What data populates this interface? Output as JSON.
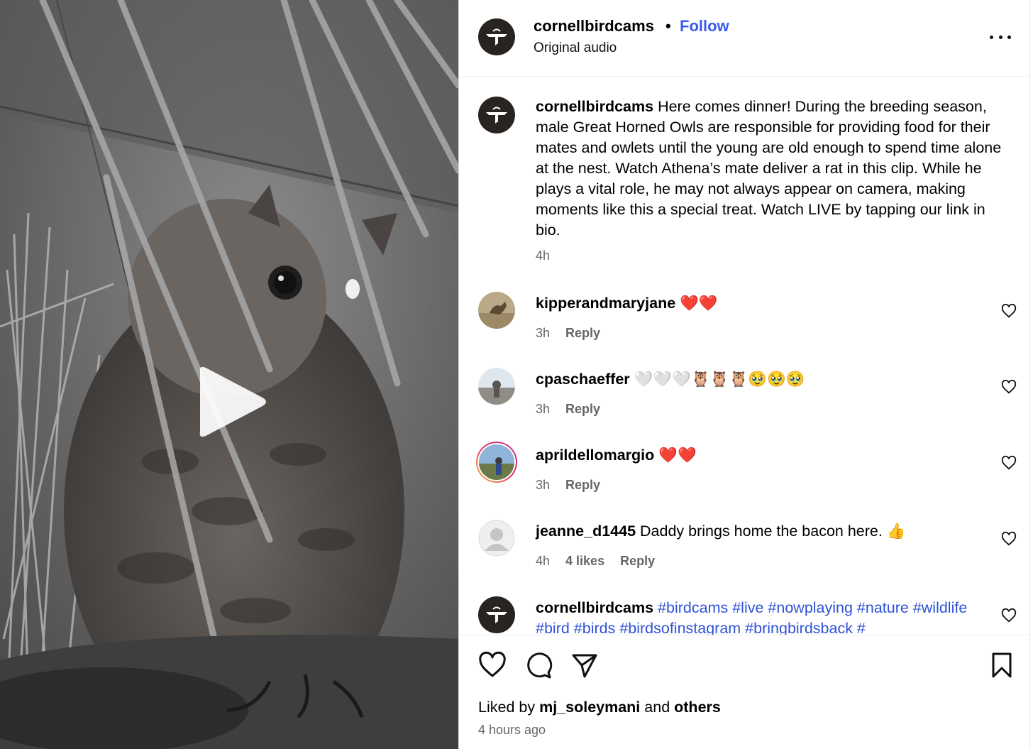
{
  "post": {
    "username": "cornellbirdcams",
    "separator": "•",
    "follow_label": "Follow",
    "audio_label": "Original audio",
    "more_icon": "more-horizontal-icon"
  },
  "video": {
    "play_icon": "play-icon"
  },
  "caption": {
    "username": "cornellbirdcams",
    "text": "Here comes dinner! During the breeding season, male Great Horned Owls are responsible for providing food for their mates and owlets until the young are old enough to spend time alone at the nest. Watch Athena’s mate deliver a rat in this clip. While he plays a vital role, he may not always appear on camera, making moments like this a special treat. Watch LIVE by tapping our link in bio.",
    "time": "4h"
  },
  "comments": [
    {
      "username": "kipperandmaryjane",
      "text": "❤️❤️",
      "time": "3h",
      "likes": "",
      "reply_label": "Reply"
    },
    {
      "username": "cpaschaeffer",
      "text": "🤍🤍🤍🦉🦉🦉🥹🥹🥹",
      "time": "3h",
      "likes": "",
      "reply_label": "Reply"
    },
    {
      "username": "aprildellomargio",
      "text": "❤️❤️",
      "time": "3h",
      "likes": "",
      "reply_label": "Reply"
    },
    {
      "username": "jeanne_d1445",
      "text": "Daddy brings home the bacon here. 👍",
      "time": "4h",
      "likes": "4 likes",
      "reply_label": "Reply"
    },
    {
      "username": "cornellbirdcams",
      "text": "#birdcams #live #nowplaying #nature #wildlife #bird #birds #birdsofinstagram #bringbirdsback #"
    }
  ],
  "footer": {
    "liked_by_prefix": "Liked by",
    "liked_by_user": "mj_soleymani",
    "and_label": "and",
    "others_label": "others",
    "posted_ago": "4 hours ago"
  },
  "colors": {
    "follow": "#3a5bef",
    "hashtag": "#2f52d8",
    "secondary_text": "#666666",
    "heart_red": "#e0262f"
  }
}
